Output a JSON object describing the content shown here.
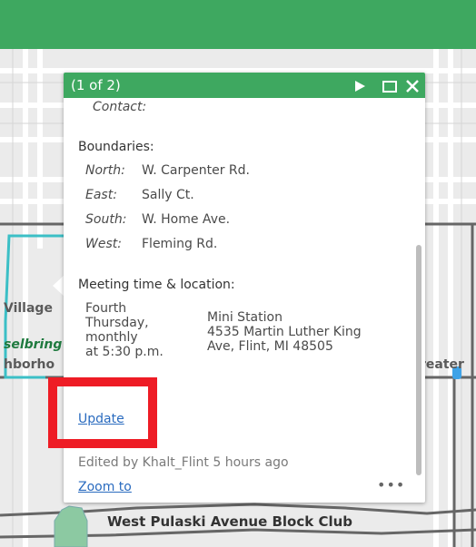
{
  "popup": {
    "title": "(1 of 2)",
    "contact_label": "Contact:",
    "boundaries_heading": "Boundaries:",
    "boundaries": [
      {
        "label": "North:",
        "value": "W. Carpenter Rd."
      },
      {
        "label": "East:",
        "value": "Sally Ct."
      },
      {
        "label": "South:",
        "value": "W. Home Ave."
      },
      {
        "label": "West:",
        "value": "Fleming Rd."
      }
    ],
    "meeting_heading": "Meeting time & location:",
    "meeting_time": [
      "Fourth",
      "Thursday,",
      "monthly",
      "at 5:30 p.m."
    ],
    "meeting_location": [
      "Mini Station",
      "4535 Martin Luther King",
      "Ave, Flint, MI 48505"
    ],
    "update_link": "Update",
    "edited": "Edited by Khalt_Flint 5 hours ago",
    "zoom_link": "Zoom to",
    "more": "•••"
  },
  "map": {
    "labels": {
      "village": "Village",
      "selbring": "selbring",
      "neighborhood": "hborho",
      "greater": "reater",
      "pulaski": "West Pulaski Avenue Block Club"
    }
  },
  "colors": {
    "accent": "#3ea860",
    "highlight": "#ee1c25",
    "link": "#2a6bbf"
  },
  "icons": {
    "next": "play-icon",
    "maximize": "maximize-icon",
    "close": "close-icon"
  }
}
